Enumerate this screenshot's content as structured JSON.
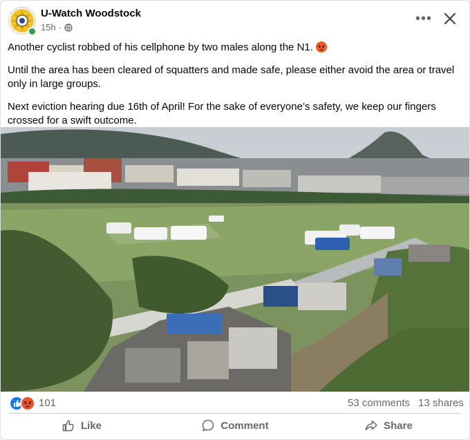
{
  "post": {
    "page_name": "U-Watch Woodstock",
    "time": "15h",
    "privacy_icon": "globe-icon",
    "paragraphs": [
      "Another cyclist robbed of his cellphone by two males along the N1.",
      "Until the area has been cleared of squatters and made safe, please either avoid the area or travel only in large groups.",
      "Next eviction hearing due 16th of April! For the sake of everyone’s safety, we keep our fingers crossed for a swift outcome."
    ],
    "emoji": "angry-face-emoji"
  },
  "stats": {
    "reaction_count": "101",
    "comments": "53 comments",
    "shares": "13 shares",
    "reactions": [
      "like",
      "angry"
    ]
  },
  "actions": {
    "like": "Like",
    "comment": "Comment",
    "share": "Share"
  },
  "colors": {
    "accent": "#1877f2",
    "angry": "#f0502a",
    "muted": "#65676b"
  }
}
